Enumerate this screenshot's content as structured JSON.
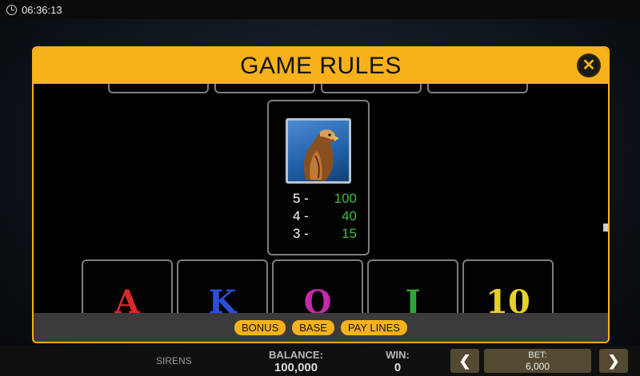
{
  "status_bar": {
    "time": "06:36:13"
  },
  "modal": {
    "title": "GAME RULES",
    "paytable": {
      "symbol": "eagle",
      "rows": [
        {
          "count": "5 -",
          "payout": "100"
        },
        {
          "count": "4 -",
          "payout": "40"
        },
        {
          "count": "3 -",
          "payout": "15"
        }
      ]
    },
    "symbols": [
      {
        "label": "A",
        "color": "#d62a2a"
      },
      {
        "label": "K",
        "color": "#2a4fd6"
      },
      {
        "label": "Q",
        "color": "#c42aa8"
      },
      {
        "label": "J",
        "color": "#2fa83a"
      },
      {
        "label": "10",
        "color": "#e6d12a"
      }
    ],
    "tabs": [
      "BONUS",
      "BASE",
      "PAY LINES"
    ]
  },
  "game_bar": {
    "game_name": "SIRENS",
    "balance_label": "BALANCE:",
    "balance_value": "100,000",
    "win_label": "WIN:",
    "win_value": "0",
    "bet_label": "BET:",
    "bet_value": "6,000",
    "prev_symbol": "❮",
    "next_symbol": "❯"
  },
  "colors": {
    "accent": "#f7b21b",
    "payout": "#3fbd3f"
  }
}
